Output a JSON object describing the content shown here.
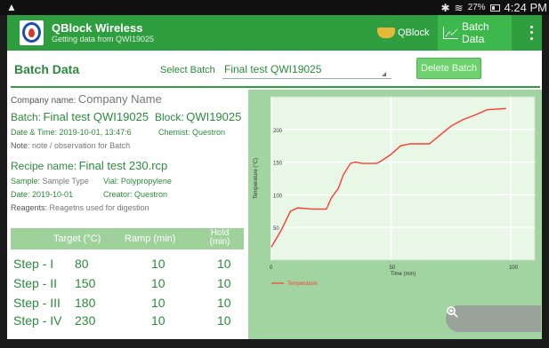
{
  "status": {
    "time": "4:24 PM",
    "battery": "27%",
    "icons": [
      "warning-icon",
      "bluetooth-icon",
      "wifi-icon",
      "battery-icon"
    ]
  },
  "app": {
    "title": "QBlock Wireless",
    "subtitle": "Getting data from QWI19025",
    "tab_qblock": "QBlock",
    "tab_batch": "Batch Data",
    "accent": "#2f9e3f"
  },
  "header": {
    "title": "Batch Data",
    "select_label": "Select Batch",
    "selected_batch": "Final test QWI19025",
    "delete_label": "Delete Batch"
  },
  "info": {
    "company_label": "Company name:",
    "company_value": "Company Name",
    "batch_label": "Batch:",
    "batch_value": "Final test QWI19025",
    "block_label": "Block:",
    "block_value": "QWI19025",
    "datetime_label": "Date & Time:",
    "datetime_value": "2019-10-01,  13:47:6",
    "chemist_label": "Chemist:",
    "chemist_value": "Questron",
    "note_label": "Note:",
    "note_value": "note / observation for Batch",
    "recipe_label": "Recipe name:",
    "recipe_value": "Final test 230.rcp",
    "sample_label": "Sample:",
    "sample_value": "Sample Type",
    "vial_label": "Vial:",
    "vial_value": "Polypropylene",
    "date_label": "Date:",
    "date_value": "2019-10-01",
    "creator_label": "Creator:",
    "creator_value": "Questron",
    "reagents_label": "Reagents:",
    "reagents_value": "Reagetns used for digestion"
  },
  "steps": {
    "headers": {
      "target": "Target (°C)",
      "ramp": "Ramp (min)",
      "hold": "Hold (min)"
    },
    "rows": [
      {
        "step": "Step - I",
        "target": "80",
        "ramp": "10",
        "hold": "10"
      },
      {
        "step": "Step - II",
        "target": "150",
        "ramp": "10",
        "hold": "10"
      },
      {
        "step": "Step - III",
        "target": "180",
        "ramp": "10",
        "hold": "10"
      },
      {
        "step": "Step - IV",
        "target": "230",
        "ramp": "10",
        "hold": "10"
      }
    ]
  },
  "chart_data": {
    "type": "line",
    "title": "",
    "xlabel": "Time (min)",
    "ylabel": "Temperature (°C)",
    "xlim": [
      0,
      110
    ],
    "ylim": [
      0,
      250
    ],
    "x_ticks": [
      0,
      50,
      100
    ],
    "y_ticks": [
      50,
      100,
      150,
      200
    ],
    "grid": true,
    "legend": "bottom-left",
    "series": [
      {
        "name": "Temperature",
        "color": "#ff3b2f",
        "x": [
          0,
          4,
          8,
          11,
          14,
          17,
          23,
          25,
          28,
          30,
          33,
          35,
          38,
          44,
          46,
          50,
          54,
          58,
          62,
          66,
          70,
          75,
          80,
          85,
          90,
          94,
          98
        ],
        "y": [
          20,
          45,
          75,
          80,
          79,
          78,
          78,
          95,
          110,
          130,
          148,
          150,
          148,
          148,
          152,
          162,
          175,
          178,
          178,
          178,
          190,
          205,
          215,
          222,
          230,
          231,
          232
        ]
      }
    ]
  },
  "zoom": {
    "icons": [
      "zoom-in-icon",
      "zoom-out-icon",
      "zoom-reset-icon"
    ]
  }
}
